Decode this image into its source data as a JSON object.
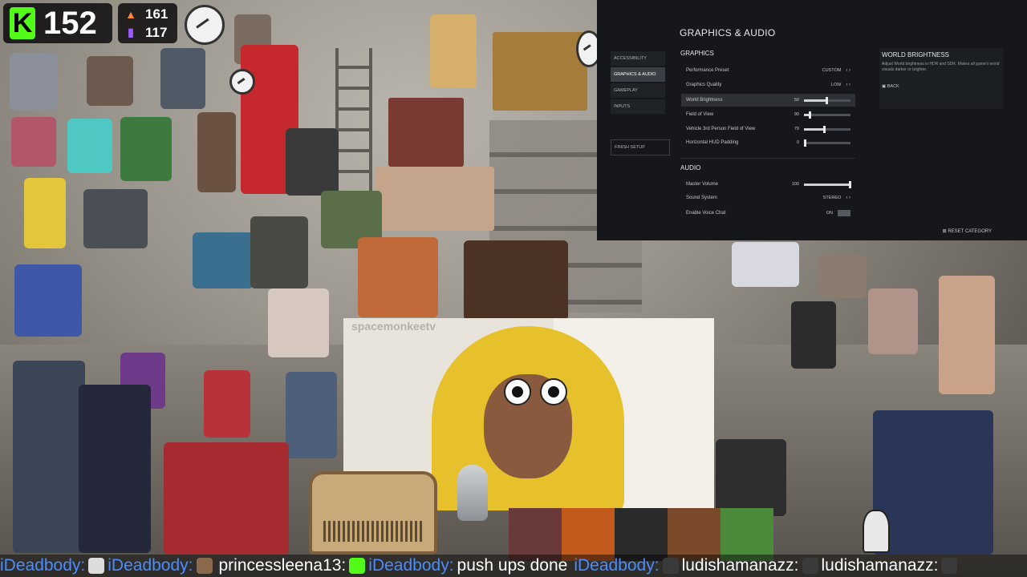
{
  "counters": {
    "kick_followers": "152",
    "stat_a": "161",
    "stat_b": "117",
    "kick_logo": "K"
  },
  "settings": {
    "page_title": "GRAPHICS & AUDIO",
    "nav": [
      "ACCESSIBILITY",
      "GRAPHICS & AUDIO",
      "GAMEPLAY",
      "INPUTS"
    ],
    "finish": "FINISH SETUP",
    "graphics_header": "GRAPHICS",
    "graphics_rows": [
      {
        "label": "Performance Preset",
        "value": "CUSTOM"
      },
      {
        "label": "Graphics Quality",
        "value": "LOW"
      },
      {
        "label": "World Brightness",
        "value": "50",
        "slider": 0.5
      },
      {
        "label": "Field of View",
        "value": "90",
        "slider": 0.13
      },
      {
        "label": "Vehicle 3rd Person Field of View",
        "value": "79",
        "slider": 0.45
      },
      {
        "label": "Horizontal HUD Padding",
        "value": "0",
        "slider": 0.0
      }
    ],
    "audio_header": "AUDIO",
    "audio_rows": [
      {
        "label": "Master Volume",
        "value": "100",
        "slider": 1.0
      },
      {
        "label": "Sound System",
        "value": "STEREO"
      },
      {
        "label": "Enable Voice Chat",
        "value": "ON"
      }
    ],
    "desc_title": "WORLD BRIGHTNESS",
    "desc_text": "Adjust World brightness in HDR and SDR. Makes all game's world visuals darker or brighter.",
    "back": "BACK",
    "reset": "RESET CATEGORY"
  },
  "main_cam": {
    "watermark": "spacemonkeetv"
  },
  "chat": [
    {
      "name": "iDeadbody:",
      "msg": ""
    },
    {
      "name": "iDeadbody:",
      "msg": ""
    },
    {
      "name": "princessleena13:",
      "msg": ""
    },
    {
      "name": "iDeadbody:",
      "msg": "push ups done"
    },
    {
      "name": "iDeadbody:",
      "msg": ""
    },
    {
      "name": "ludishamanazz:",
      "msg": ""
    },
    {
      "name": "ludishamanazz:",
      "msg": ""
    }
  ],
  "colors": {
    "kick_green": "#53fc18",
    "chat_name": "#4a8cff",
    "panel_bg": "#15171a"
  }
}
